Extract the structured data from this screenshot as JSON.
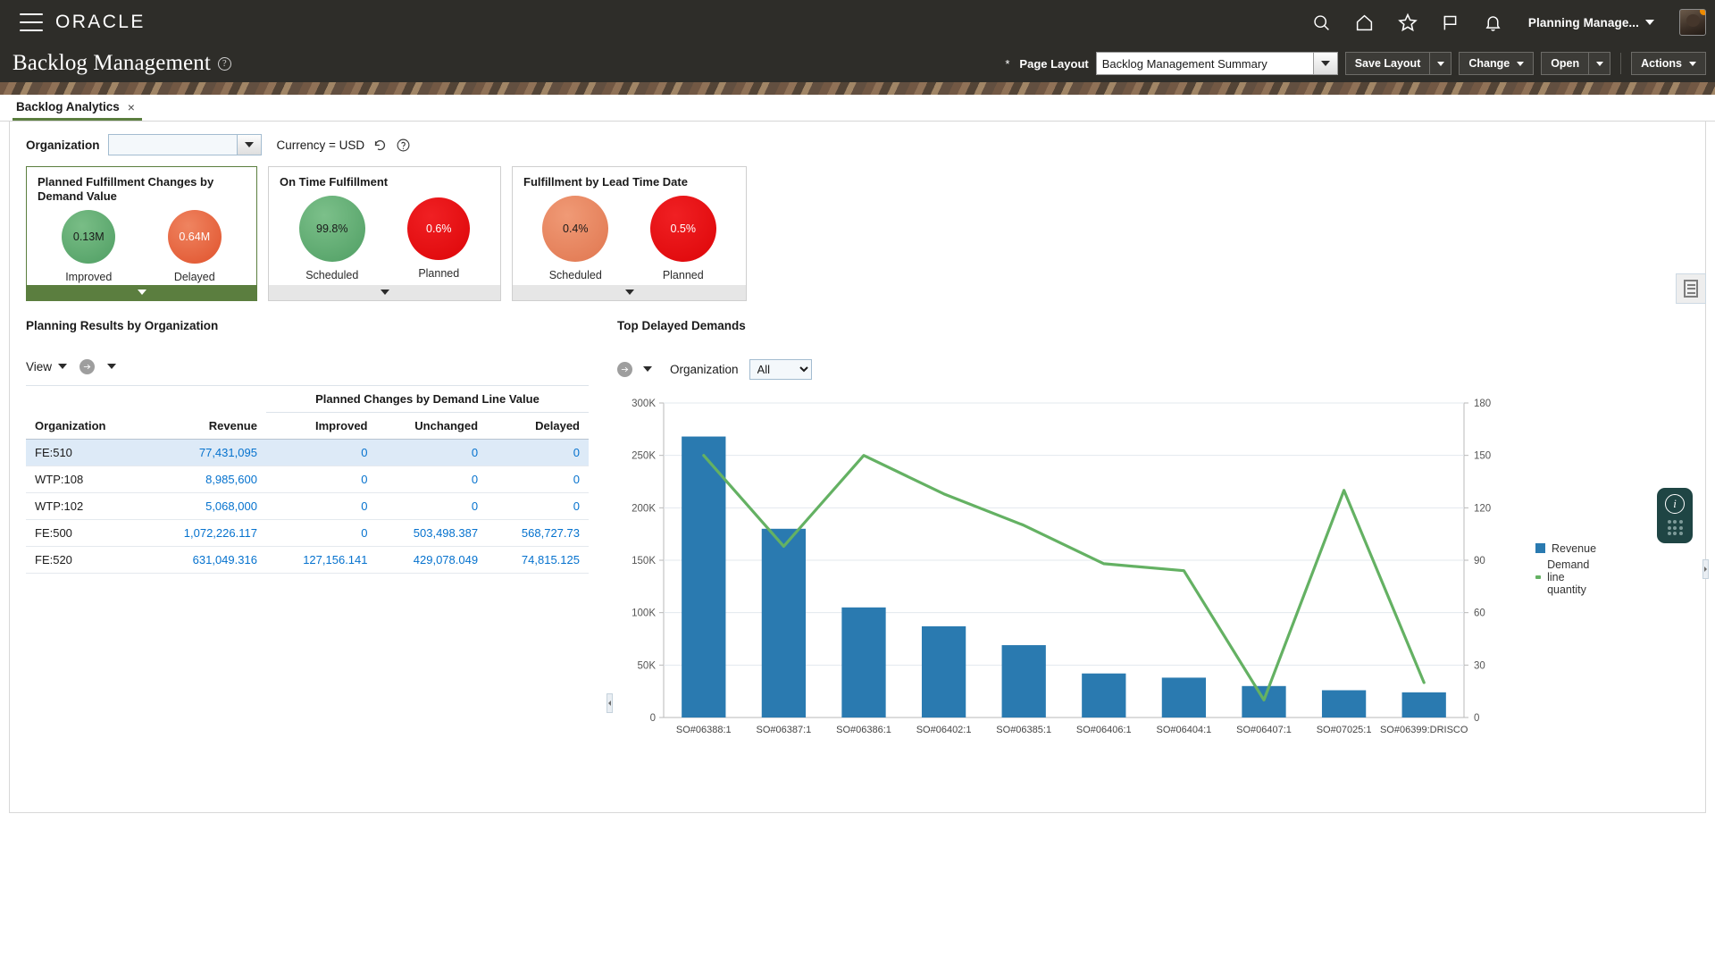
{
  "global_header": {
    "brand": "ORACLE",
    "icons": [
      "menu-icon",
      "search-icon",
      "home-icon",
      "favorites-star-icon",
      "flag-icon",
      "notifications-bell-icon"
    ],
    "user_name": "Planning Manage...",
    "avatar_alt": "user-avatar"
  },
  "title_bar": {
    "page_title": "Backlog Management",
    "help_glyph": "?",
    "required_marker": "*",
    "page_layout_label": "Page Layout",
    "page_layout_value": "Backlog Management Summary",
    "buttons": {
      "save_layout": "Save Layout",
      "change": "Change",
      "open": "Open",
      "actions": "Actions"
    }
  },
  "tab": {
    "label": "Backlog Analytics",
    "close_glyph": "×"
  },
  "filters": {
    "organization_label": "Organization",
    "organization_value": "",
    "currency_text": "Currency = USD",
    "refresh_icon": "refresh-icon",
    "help_icon": "help-icon"
  },
  "kpi_cards": [
    {
      "title": "Planned Fulfillment Changes by Demand Value",
      "footer_style": "green",
      "bubbles": [
        {
          "value": "0.13M",
          "label": "Improved",
          "color": "#5cab6e",
          "size": 60,
          "text_color": "#1a1a1a"
        },
        {
          "value": "0.64M",
          "label": "Delayed",
          "color": "#e8603c",
          "size": 60,
          "text_color": "#ffffff"
        }
      ]
    },
    {
      "title": "On Time Fulfillment",
      "footer_style": "grey",
      "bubbles": [
        {
          "value": "99.8%",
          "label": "Scheduled",
          "color": "#5cab6e",
          "size": 74,
          "text_color": "#1a1a1a"
        },
        {
          "value": "0.6%",
          "label": "Planned",
          "color": "#e8161a",
          "size": 70,
          "text_color": "#ffffff"
        }
      ]
    },
    {
      "title": "Fulfillment by Lead Time Date",
      "footer_style": "grey",
      "bubbles": [
        {
          "value": "0.4%",
          "label": "Scheduled",
          "color": "#e9835c",
          "size": 74,
          "text_color": "#1a1a1a"
        },
        {
          "value": "0.5%",
          "label": "Planned",
          "color": "#e8161a",
          "size": 74,
          "text_color": "#ffffff"
        }
      ]
    }
  ],
  "left_section": {
    "title": "Planning Results by Organization",
    "view_label": "View",
    "detach_icon": "detach-arrow-icon",
    "table": {
      "group_header": "Planned Changes by Demand Line Value",
      "columns": [
        "Organization",
        "Revenue",
        "Improved",
        "Unchanged",
        "Delayed"
      ],
      "rows": [
        {
          "organization": "FE:510",
          "revenue": "77,431,095",
          "improved": "0",
          "unchanged": "0",
          "delayed": "0",
          "selected": true
        },
        {
          "organization": "WTP:108",
          "revenue": "8,985,600",
          "improved": "0",
          "unchanged": "0",
          "delayed": "0",
          "selected": false
        },
        {
          "organization": "WTP:102",
          "revenue": "5,068,000",
          "improved": "0",
          "unchanged": "0",
          "delayed": "0",
          "selected": false
        },
        {
          "organization": "FE:500",
          "revenue": "1,072,226.117",
          "improved": "0",
          "unchanged": "503,498.387",
          "delayed": "568,727.73",
          "selected": false
        },
        {
          "organization": "FE:520",
          "revenue": "631,049.316",
          "improved": "127,156.141",
          "unchanged": "429,078.049",
          "delayed": "74,815.125",
          "selected": false
        }
      ]
    }
  },
  "right_section": {
    "title": "Top Delayed Demands",
    "detach_icon": "detach-arrow-icon",
    "organization_label": "Organization",
    "organization_value": "All",
    "organization_options": [
      "All"
    ]
  },
  "chart_data": {
    "type": "bar",
    "title": "Top Delayed Demands",
    "categories": [
      "SO#06388:1",
      "SO#06387:1",
      "SO#06386:1",
      "SO#06402:1",
      "SO#06385:1",
      "SO#06406:1",
      "SO#06404:1",
      "SO#06407:1",
      "SO#07025:1",
      "SO#06399:DRISCO"
    ],
    "series": [
      {
        "name": "Revenue",
        "type": "bar",
        "axis": "left",
        "color": "#2a7ab0",
        "values": [
          268000,
          180000,
          105000,
          87000,
          69000,
          42000,
          38000,
          30000,
          26000,
          24000
        ]
      },
      {
        "name": "Demand line quantity",
        "type": "line",
        "axis": "right",
        "color": "#64b163",
        "values": [
          150,
          98,
          150,
          128,
          110,
          88,
          84,
          10,
          130,
          20
        ]
      }
    ],
    "left_axis": {
      "label": "",
      "min": 0,
      "max": 300000,
      "step": 50000,
      "ticks": [
        "0",
        "50K",
        "100K",
        "150K",
        "200K",
        "250K",
        "300K"
      ]
    },
    "right_axis": {
      "label": "",
      "min": 0,
      "max": 180,
      "step": 30,
      "ticks": [
        "0",
        "30",
        "60",
        "90",
        "120",
        "150",
        "180"
      ]
    },
    "grid": true,
    "legend_position": "right",
    "legend": [
      "Revenue",
      "Demand line quantity"
    ]
  },
  "right_rail": {
    "panel_icon": "document-panel-icon",
    "float_widget_icon": "info-icon",
    "float_widget_grid": "apps-grid-icon"
  }
}
